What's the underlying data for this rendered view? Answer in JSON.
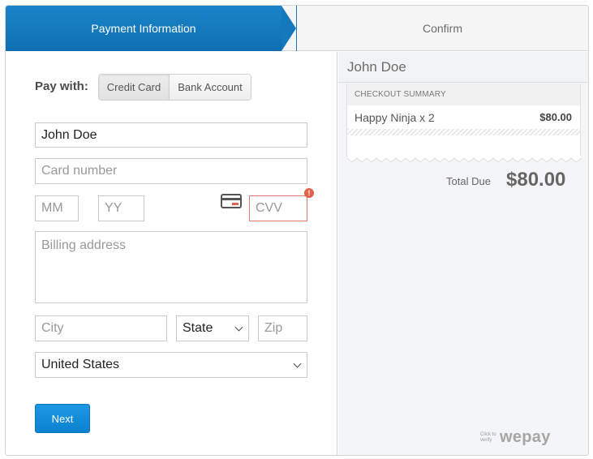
{
  "steps": {
    "active": "Payment Information",
    "next": "Confirm"
  },
  "form": {
    "pay_with_label": "Pay with:",
    "methods": [
      "Credit Card",
      "Bank Account"
    ],
    "name_value": "John Doe",
    "card_placeholder": "Card number",
    "mm_placeholder": "MM",
    "slash": "/",
    "yy_placeholder": "YY",
    "cvv_placeholder": "CVV",
    "cvv_error_icon": "!",
    "billing_placeholder": "Billing address",
    "city_placeholder": "City",
    "state_value": "State",
    "zip_placeholder": "Zip",
    "country_value": "United States",
    "next_label": "Next"
  },
  "summary": {
    "payer_name": "John Doe",
    "heading": "CHECKOUT SUMMARY",
    "items": [
      {
        "name": "Happy Ninja x 2",
        "price": "$80.00"
      }
    ],
    "total_label": "Total Due",
    "total_value": "$80.00"
  },
  "footer": {
    "verify_text": "Click to verify",
    "brand": "wepay"
  },
  "colors": {
    "accent": "#0f6fb2",
    "button": "#0a82d0",
    "error": "#e3604d"
  },
  "icons": [
    "card-icon",
    "error-icon",
    "chevron-down-icon"
  ]
}
